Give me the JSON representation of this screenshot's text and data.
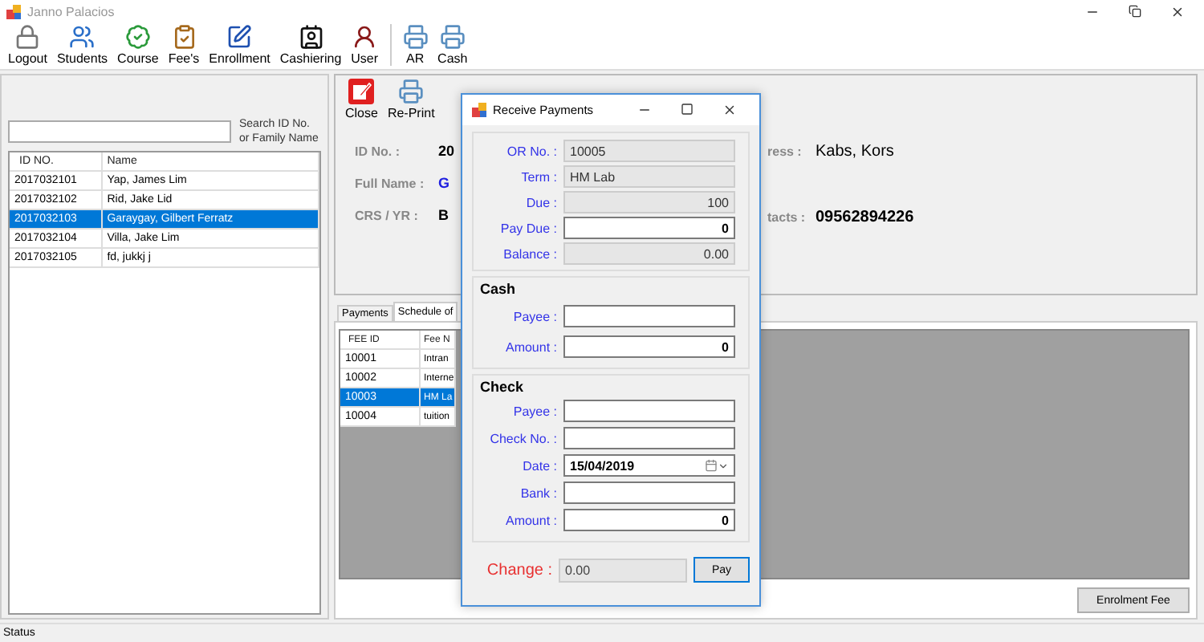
{
  "window": {
    "title": "Janno Palacios"
  },
  "toolbar": {
    "main": [
      {
        "label": "Logout",
        "kind": "lock"
      },
      {
        "label": "Students",
        "kind": "people"
      },
      {
        "label": "Course",
        "kind": "badge"
      },
      {
        "label": "Fee's",
        "kind": "clipboard"
      },
      {
        "label": "Enrollment",
        "kind": "pen"
      },
      {
        "label": "Cashiering",
        "kind": "cashier"
      },
      {
        "label": "User",
        "kind": "user"
      }
    ],
    "reports": [
      {
        "label": "AR",
        "kind": "printer"
      },
      {
        "label": "Cash",
        "kind": "printer"
      }
    ]
  },
  "search": {
    "label": "Search ID No. or Family Name"
  },
  "students": {
    "columns": [
      "ID NO.",
      "Name"
    ],
    "rows": [
      {
        "id": "2017032101",
        "name": "Yap, James Lim",
        "selected": false
      },
      {
        "id": "2017032102",
        "name": "Rid, Jake Lid",
        "selected": false
      },
      {
        "id": "2017032103",
        "name": "Garaygay, Gilbert Ferratz",
        "selected": true
      },
      {
        "id": "2017032104",
        "name": "Villa, Jake Lim",
        "selected": false
      },
      {
        "id": "2017032105",
        "name": "fd, jukkj j",
        "selected": false
      }
    ]
  },
  "detail": {
    "toolbar": [
      {
        "label": "Close",
        "kind": "close"
      },
      {
        "label": "Re-Print",
        "kind": "printer"
      }
    ],
    "fields": [
      {
        "label": "ID No. :",
        "value": "20",
        "kind": "plain"
      },
      {
        "label": "Full Name :",
        "value": "G",
        "kind": "name"
      },
      {
        "label": "CRS / YR  :",
        "value": "B",
        "kind": "plain"
      }
    ],
    "address": {
      "label": "ress :",
      "value": "Kabs, Kors"
    },
    "contacts": {
      "label": "tacts :",
      "value": "09562894226"
    }
  },
  "tabs": [
    {
      "label": "Payments",
      "selected": false
    },
    {
      "label": "Schedule of",
      "selected": true
    }
  ],
  "fees": {
    "columns": [
      "FEE ID",
      "Fee N"
    ],
    "rows": [
      {
        "id": "10001",
        "name": "Intran",
        "selected": false
      },
      {
        "id": "10002",
        "name": "Interne",
        "selected": false
      },
      {
        "id": "10003",
        "name": "HM La",
        "selected": true
      },
      {
        "id": "10004",
        "name": "tuition",
        "selected": false
      }
    ]
  },
  "enrolment_button": "Enrolment Fee",
  "status_bar": "Status",
  "dialog": {
    "title": "Receive Payments",
    "summary": [
      {
        "label": "OR No. :",
        "value": "10005",
        "kind": "text"
      },
      {
        "label": "Term :",
        "value": "HM Lab",
        "kind": "text"
      },
      {
        "label": "Due :",
        "value": "100",
        "kind": "amount"
      },
      {
        "label": "Pay Due :",
        "value": "0",
        "kind": "entry"
      },
      {
        "label": "Balance :",
        "value": "0.00",
        "kind": "amount"
      }
    ],
    "cash": {
      "title": "Cash",
      "fields": [
        {
          "label": "Payee :",
          "kind": "entry"
        },
        {
          "label": "Amount :",
          "value": "0",
          "kind": "entry"
        }
      ]
    },
    "check": {
      "title": "Check",
      "fields": [
        {
          "label": "Payee :",
          "kind": "entry"
        },
        {
          "label": "Check No. :",
          "kind": "entry"
        },
        {
          "label": "Date :",
          "value": "15/04/2019",
          "kind": "date"
        },
        {
          "label": "Bank :",
          "kind": "entry"
        },
        {
          "label": "Amount :",
          "value": "0",
          "kind": "entry"
        }
      ]
    },
    "change": {
      "label": "Change :",
      "value": "0.00"
    },
    "pay_button": "Pay"
  }
}
